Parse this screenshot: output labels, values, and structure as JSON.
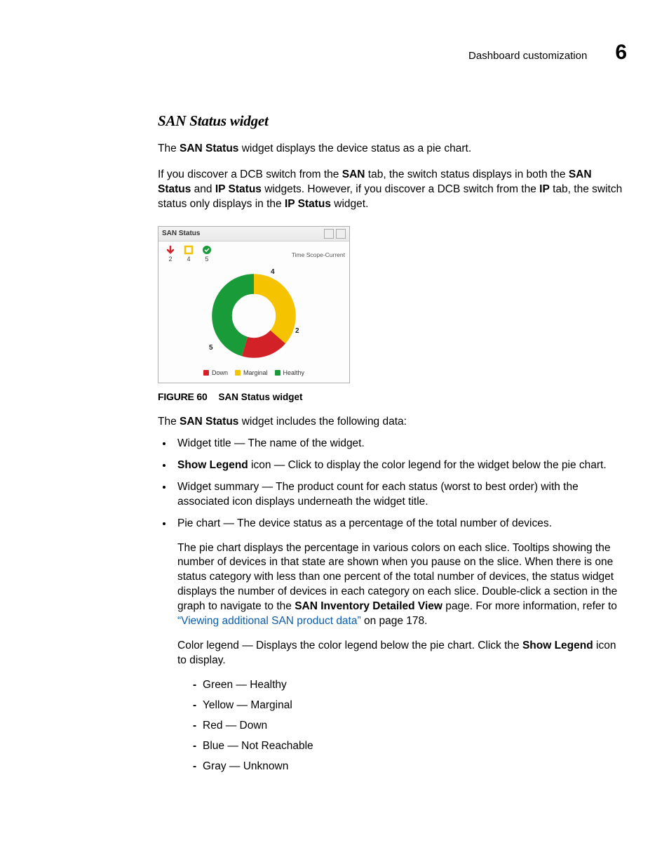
{
  "header": {
    "text": "Dashboard customization",
    "chapter": "6"
  },
  "title": "SAN Status widget",
  "p1_pre": "The ",
  "p1_bold": "SAN Status",
  "p1_post": " widget displays the device status as a pie chart.",
  "p2_a": "If you discover a DCB switch from the ",
  "p2_b": "SAN",
  "p2_c": " tab, the switch status displays in both the ",
  "p2_d": "SAN Status",
  "p2_e": " and ",
  "p2_f": "IP Status",
  "p2_g": " widgets. However, if you discover a DCB switch from the ",
  "p2_h": "IP",
  "p2_i": " tab, the switch status only displays in the ",
  "p2_j": "IP Status",
  "p2_k": " widget.",
  "widget": {
    "title": "SAN Status",
    "scope": "Time Scope-Current",
    "summary": {
      "down": "2",
      "marginal": "4",
      "healthy": "5"
    },
    "labels": {
      "top": "4",
      "left": "5",
      "right": "2"
    },
    "legend": {
      "down": "Down",
      "marginal": "Marginal",
      "healthy": "Healthy"
    },
    "colors": {
      "down": "#d32227",
      "marginal": "#f6c300",
      "healthy": "#1a9b3a"
    }
  },
  "chart_data": {
    "type": "pie",
    "title": "SAN Status",
    "series": [
      {
        "name": "Down",
        "value": 2,
        "color": "#d32227"
      },
      {
        "name": "Marginal",
        "value": 4,
        "color": "#f6c300"
      },
      {
        "name": "Healthy",
        "value": 5,
        "color": "#1a9b3a"
      }
    ]
  },
  "figure_caption_label": "FIGURE 60",
  "figure_caption_text": "SAN Status widget",
  "p3_a": "The ",
  "p3_b": "SAN Status",
  "p3_c": " widget includes the following data:",
  "b1": "Widget title — The name of the widget.",
  "b2_a": "Show Legend",
  "b2_b": " icon — Click to display the color legend for the widget below the pie chart.",
  "b3": "Widget summary — The product count for each status (worst to best order) with the associated icon displays underneath the widget title.",
  "b4": "Pie chart — The device status as a percentage of the total number of devices.",
  "b4p_a": "The pie chart displays the percentage in various colors on each slice. Tooltips showing the number of devices in that state are shown when you pause on the slice. When there is one status category with less than one percent of the total number of devices, the status widget displays the number of devices in each category on each slice. Double-click a section in the graph to navigate to the ",
  "b4p_b": "SAN Inventory Detailed View",
  "b4p_c": " page. For more information, refer to ",
  "b4p_link": "“Viewing additional SAN product data”",
  "b4p_d": " on page 178.",
  "p4_a": "Color legend — Displays the color legend below the pie chart. Click the ",
  "p4_b": "Show Legend",
  "p4_c": " icon to display.",
  "dashes": [
    "Green — Healthy",
    "Yellow — Marginal",
    "Red — Down",
    "Blue — Not Reachable",
    "Gray — Unknown"
  ]
}
